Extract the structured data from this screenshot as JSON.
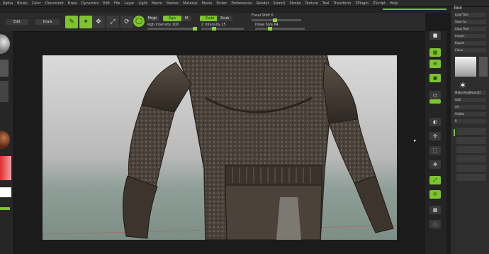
{
  "menu": [
    "Alpha",
    "Brush",
    "Color",
    "Document",
    "Draw",
    "Dynamics",
    "Edit",
    "File",
    "Layer",
    "Light",
    "Macro",
    "Marker",
    "Material",
    "Movie",
    "Picker",
    "Preferences",
    "Render",
    "Stencil",
    "Stroke",
    "Texture",
    "Tool",
    "Transform",
    "ZPlugin",
    "ZScript",
    "Help"
  ],
  "toolbar": {
    "edit": "Edit",
    "draw": "Draw",
    "move_icon": "move-icon",
    "scale_icon": "scale-icon",
    "rotate_icon": "rotate-icon",
    "mrgb": "Mrgb",
    "rgb": "Rgb",
    "m": "M",
    "zadd": "Zadd",
    "zsub": "Zsub",
    "focal_shift": "Focal Shift 0",
    "draw_size": "Draw Size 64",
    "z_intensity": "Z Intensity 25",
    "rgb_intensity": "Rgb Intensity 100"
  },
  "canvas": {
    "subject": "armored figure sculpt"
  },
  "right_panel": {
    "title": "Tool",
    "items": [
      "Load Tool",
      "Save As",
      "Copy Tool",
      "Import",
      "Export",
      "Clone",
      "Make PolyMesh3D",
      "GoZ",
      "All",
      "Visible",
      "R"
    ]
  },
  "colors": {
    "accent": "#7ec42f",
    "bg": "#1b1b1b"
  }
}
